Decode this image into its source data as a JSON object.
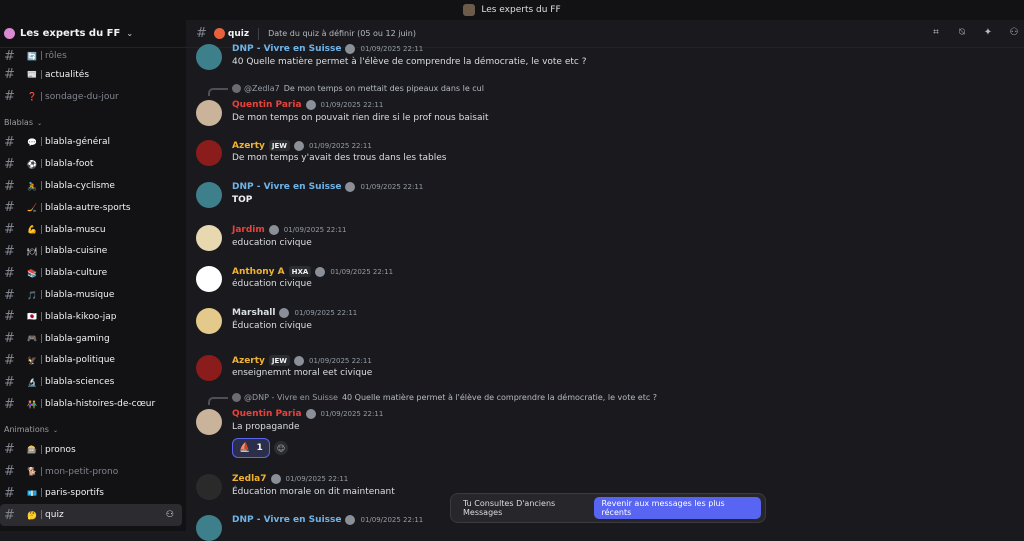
{
  "app": {
    "title": "Les experts du FF"
  },
  "server": {
    "name": "Les experts du FF"
  },
  "sidebar": {
    "channels_top": [
      {
        "emoji": "🔄",
        "name": "rôles",
        "muted": true
      },
      {
        "emoji": "📰",
        "name": "actualités",
        "muted": false
      },
      {
        "emoji": "❓",
        "name": "sondage-du-jour",
        "muted": true
      }
    ],
    "cat_blablas": "Blablas",
    "channels_blablas": [
      {
        "emoji": "💬",
        "name": "blabla-général"
      },
      {
        "emoji": "⚽",
        "name": "blabla-foot"
      },
      {
        "emoji": "🚴",
        "name": "blabla-cyclisme"
      },
      {
        "emoji": "🏒",
        "name": "blabla-autre-sports"
      },
      {
        "emoji": "💪",
        "name": "blabla-muscu"
      },
      {
        "emoji": "🍽",
        "name": "blabla-cuisine"
      },
      {
        "emoji": "📚",
        "name": "blabla-culture"
      },
      {
        "emoji": "🎵",
        "name": "blabla-musique"
      },
      {
        "emoji": "🇯🇵",
        "name": "blabla-kikoo-jap"
      },
      {
        "emoji": "🎮",
        "name": "blabla-gaming"
      },
      {
        "emoji": "🦅",
        "name": "blabla-politique"
      },
      {
        "emoji": "🔬",
        "name": "blabla-sciences"
      },
      {
        "emoji": "👫",
        "name": "blabla-histoires-de-cœur"
      }
    ],
    "cat_animations": "Animations",
    "channels_animations": [
      {
        "emoji": "🎰",
        "name": "pronos",
        "muted": false
      },
      {
        "emoji": "🐕",
        "name": "mon-petit-prono",
        "muted": true
      },
      {
        "emoji": "💶",
        "name": "paris-sportifs",
        "muted": false
      }
    ],
    "active_channel": {
      "emoji": "🤔",
      "name": "quiz"
    }
  },
  "header": {
    "channel_name": "quiz",
    "topic": "Date du quiz à définir (05 ou 12 juin)"
  },
  "messages": [
    {
      "author": "DNP - Vivre en Suisse",
      "color": "#6fb3e8",
      "time": "01/09/2025 22:11",
      "text": "40 Quelle matière permet à l'élève de comprendre la démocratie, le vote etc ?"
    },
    {
      "reply_to": "@Zedla7",
      "reply_text": "De mon temps on mettait des pipeaux dans le cul",
      "author": "Quentin Paria",
      "color": "#e8423c",
      "time": "01/09/2025 22:11",
      "text": "De mon temps on pouvait rien dire si le prof nous baisait"
    },
    {
      "author": "Azerty",
      "color": "#f0b232",
      "badge": "JEW",
      "time": "01/09/2025 22:11",
      "text": "De mon temps y'avait des trous dans les tables"
    },
    {
      "author": "DNP - Vivre en Suisse",
      "color": "#6fb3e8",
      "time": "01/09/2025 22:11",
      "text": "TOP"
    },
    {
      "author": "Jardim",
      "color": "#e8423c",
      "time": "01/09/2025 22:11",
      "text": "education civique"
    },
    {
      "author": "Anthony A",
      "color": "#f0b232",
      "badge": "HXA",
      "time": "01/09/2025 22:11",
      "text": "éducation civique"
    },
    {
      "author": "Marshall",
      "color": "#dbdee1",
      "time": "01/09/2025 22:11",
      "text": "Éducation civique"
    },
    {
      "author": "Azerty",
      "color": "#f0b232",
      "badge": "JEW",
      "time": "01/09/2025 22:11",
      "text": "enseignemnt moral eet civique"
    },
    {
      "reply_to": "@DNP - Vivre en Suisse",
      "reply_text": "40 Quelle matière permet à l'élève de comprendre la démocratie, le vote etc ?",
      "author": "Quentin Paria",
      "color": "#e8423c",
      "time": "01/09/2025 22:11",
      "text": "La propagande",
      "reaction_count": "1"
    },
    {
      "author": "Zedla7",
      "color": "#f0b232",
      "time": "01/09/2025 22:11",
      "text": "Éducation morale on dit maintenant"
    },
    {
      "author": "DNP - Vivre en Suisse",
      "color": "#6fb3e8",
      "time": "01/09/2025 22:11",
      "text": ""
    }
  ],
  "jump_bar": {
    "label": "Tu Consultes D'anciens Messages",
    "button": "Revenir aux messages les plus récents"
  },
  "colors": {
    "accent": "#5865f2",
    "background": "#1a1a1e",
    "sidebar": "#121214"
  }
}
